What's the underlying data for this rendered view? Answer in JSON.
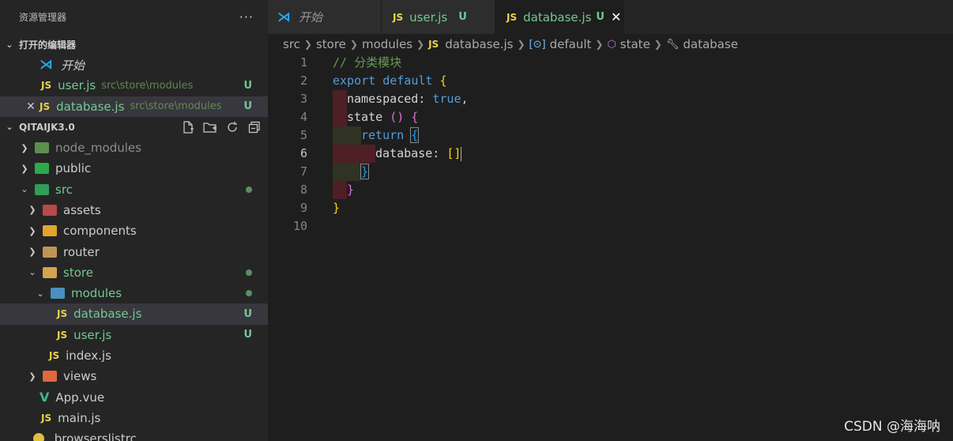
{
  "explorer": {
    "title": "资源管理器",
    "more": "···"
  },
  "open_editors": {
    "title": "打开的编辑器",
    "items": [
      {
        "icon": "vscode-icon",
        "name": "开始",
        "desc": "",
        "badge": ""
      },
      {
        "icon": "js-icon",
        "icon_text": "JS",
        "name": "user.js",
        "desc": "src\\store\\modules",
        "badge": "U"
      },
      {
        "icon": "js-icon",
        "icon_text": "JS",
        "name": "database.js",
        "desc": "src\\store\\modules",
        "badge": "U"
      }
    ]
  },
  "project": {
    "title": "QITAIJK3.0",
    "tree": [
      {
        "name": "node_modules",
        "badge": ""
      },
      {
        "name": "public",
        "badge": ""
      },
      {
        "name": "src",
        "badge": "dot"
      },
      {
        "name": "assets",
        "badge": ""
      },
      {
        "name": "components",
        "badge": ""
      },
      {
        "name": "router",
        "badge": ""
      },
      {
        "name": "store",
        "badge": "dot"
      },
      {
        "name": "modules",
        "badge": "dot"
      },
      {
        "name": "database.js",
        "badge": "U",
        "icon_text": "JS"
      },
      {
        "name": "user.js",
        "badge": "U",
        "icon_text": "JS"
      },
      {
        "name": "index.js",
        "badge": "",
        "icon_text": "JS"
      },
      {
        "name": "views",
        "badge": ""
      },
      {
        "name": "App.vue",
        "badge": "",
        "icon_text": "V"
      },
      {
        "name": "main.js",
        "badge": "",
        "icon_text": "JS"
      },
      {
        "name": ".browserslistrc",
        "badge": ""
      }
    ]
  },
  "tabs": [
    {
      "label": "开始",
      "badge": ""
    },
    {
      "label": "user.js",
      "icon_text": "JS",
      "badge": "U"
    },
    {
      "label": "database.js",
      "icon_text": "JS",
      "badge": "U",
      "close": "✕"
    }
  ],
  "breadcrumb": [
    "src",
    "store",
    "modules",
    "database.js",
    "default",
    "state",
    "database"
  ],
  "code": {
    "line_numbers": [
      "1",
      "2",
      "3",
      "4",
      "5",
      "6",
      "7",
      "8",
      "9",
      "10"
    ],
    "l1": "// 分类模块",
    "l2_kw1": "export",
    "l2_kw2": "default",
    "l2_br": "{",
    "l3_prop": "namespaced:",
    "l3_val": "true",
    "l3_comma": ",",
    "l4_prop": "state",
    "l4_paren": "()",
    "l4_br": "{",
    "l5_kw": "return",
    "l5_br": "{",
    "l6_prop": "database:",
    "l6_val": "[]",
    "l7_br": "}",
    "l8_br": "}",
    "l9_br": "}"
  },
  "watermark": "CSDN @海海呐",
  "colors": {
    "untracked": "#73c991",
    "js_icon": "#e8d44d",
    "keyword": "#569cd6",
    "comment": "#6a9955"
  }
}
